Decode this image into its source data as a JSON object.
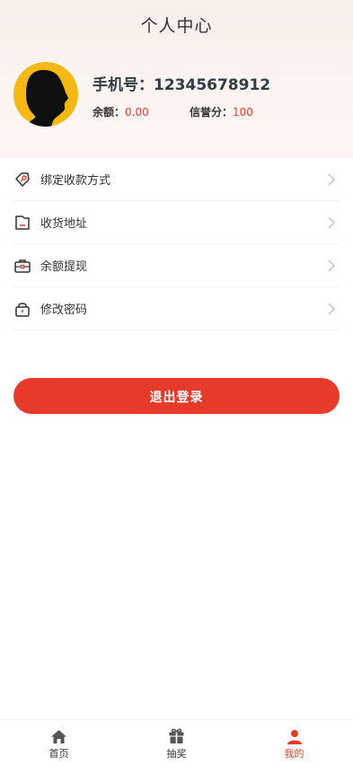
{
  "header": {
    "title": "个人中心"
  },
  "profile": {
    "phone_label": "手机号：",
    "phone_value": "12345678912",
    "balance_label": "余额：",
    "balance_value": "0.00",
    "credit_label": "信誉分：",
    "credit_value": "100"
  },
  "menu": {
    "items": [
      {
        "label": "绑定收款方式",
        "icon": "payment-tag-icon"
      },
      {
        "label": "收货地址",
        "icon": "address-icon"
      },
      {
        "label": "余额提现",
        "icon": "wallet-icon"
      },
      {
        "label": "修改密码",
        "icon": "lock-icon"
      }
    ]
  },
  "logout": {
    "label": "退出登录"
  },
  "tabbar": {
    "items": [
      {
        "label": "首页",
        "icon": "home-icon",
        "active": false
      },
      {
        "label": "抽奖",
        "icon": "gift-icon",
        "active": false
      },
      {
        "label": "我的",
        "icon": "user-icon",
        "active": true
      }
    ]
  },
  "colors": {
    "accent": "#e63a2a",
    "avatar_bg": "#f5b915",
    "header_bg": "#f8efeb"
  }
}
